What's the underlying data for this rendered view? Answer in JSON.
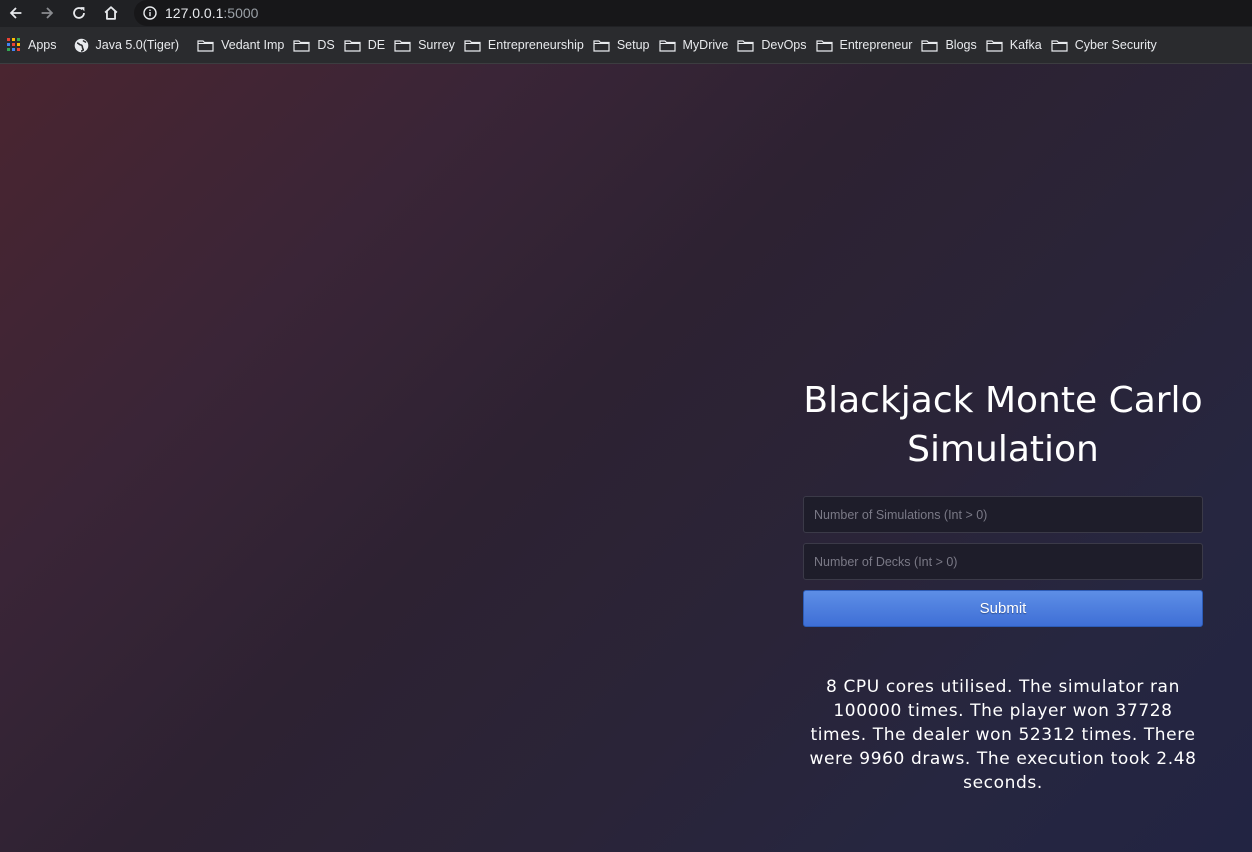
{
  "browser": {
    "url_host": "127.0.0.1",
    "url_port": ":5000",
    "icons": {
      "back": "arrow-left-icon",
      "forward": "arrow-right-icon",
      "reload": "reload-icon",
      "home": "home-icon",
      "info": "info-icon"
    }
  },
  "bookmarks": [
    {
      "label": "Apps",
      "icon": "apps-grid-icon"
    },
    {
      "label": "Java 5.0(Tiger)",
      "icon": "globe-icon"
    },
    {
      "label": "Vedant Imp",
      "icon": "folder-icon"
    },
    {
      "label": "DS",
      "icon": "folder-icon"
    },
    {
      "label": "DE",
      "icon": "folder-icon"
    },
    {
      "label": "Surrey",
      "icon": "folder-icon"
    },
    {
      "label": "Entrepreneurship",
      "icon": "folder-icon"
    },
    {
      "label": "Setup",
      "icon": "folder-icon"
    },
    {
      "label": "MyDrive",
      "icon": "folder-icon"
    },
    {
      "label": "DevOps",
      "icon": "folder-icon"
    },
    {
      "label": "Entrepreneur",
      "icon": "folder-icon"
    },
    {
      "label": "Blogs",
      "icon": "folder-icon"
    },
    {
      "label": "Kafka",
      "icon": "folder-icon"
    },
    {
      "label": "Cyber Security",
      "icon": "folder-icon"
    }
  ],
  "page": {
    "title": "Blackjack Monte Carlo Simulation",
    "form": {
      "simulations_placeholder": "Number of Simulations (Int > 0)",
      "simulations_value": "",
      "decks_placeholder": "Number of Decks (Int > 0)",
      "decks_value": "",
      "submit_label": "Submit"
    },
    "result": "8 CPU cores utilised. The simulator ran 100000 times. The player won 37728 times. The dealer won 52312 times. There were 9960 draws. The execution took 2.48 seconds."
  },
  "colors": {
    "toolbar_bg": "#202124",
    "bookmarks_bg": "#2a2b2e",
    "submit_button": "#4a7bdc",
    "page_gradient_start": "#4a2530",
    "page_gradient_end": "#222442"
  }
}
